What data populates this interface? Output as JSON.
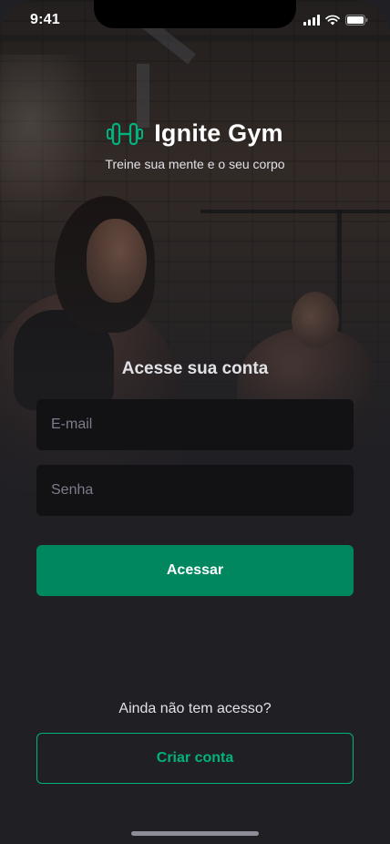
{
  "status_bar": {
    "time": "9:41",
    "icons": [
      "cellular-signal-icon",
      "wifi-icon",
      "battery-icon"
    ]
  },
  "logo": {
    "icon": "dumbbell-icon",
    "app_name": "Ignite Gym",
    "tagline": "Treine sua mente e o seu corpo"
  },
  "login_form": {
    "title": "Acesse sua conta",
    "email": {
      "value": "",
      "placeholder": "E-mail"
    },
    "password": {
      "value": "",
      "placeholder": "Senha"
    },
    "submit_label": "Acessar"
  },
  "signup": {
    "prompt": "Ainda não tem acesso?",
    "button_label": "Criar conta"
  },
  "colors": {
    "background": "#202024",
    "input_background": "#121214",
    "primary": "#00875F",
    "accent": "#00B37E",
    "text": "#E1E1E6",
    "placeholder": "#7C7C8A"
  }
}
